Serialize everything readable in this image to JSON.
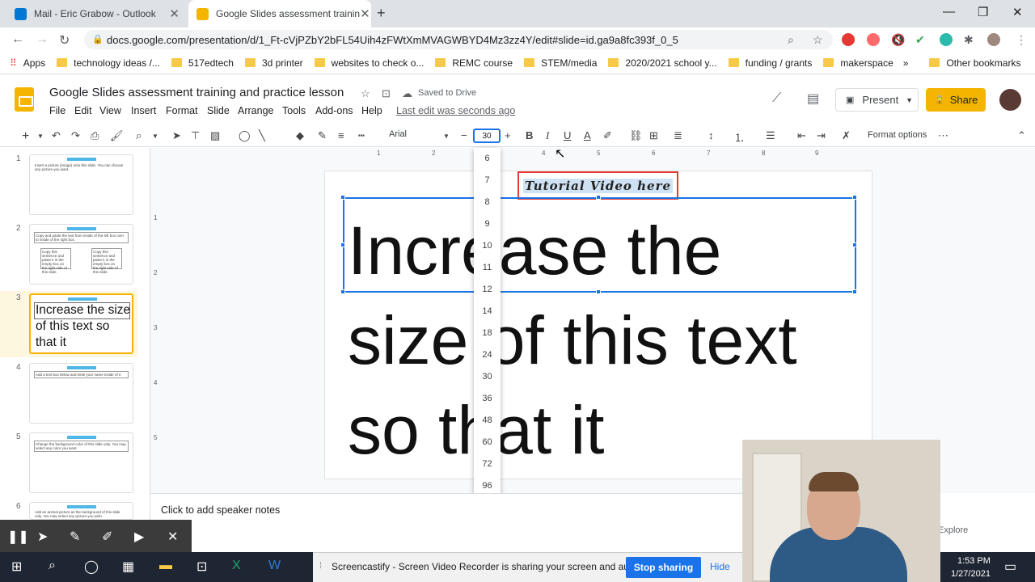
{
  "browser": {
    "tabs": [
      {
        "title": "Mail - Eric Grabow - Outlook",
        "favicon_color": "#0078d4"
      },
      {
        "title": "Google Slides assessment trainin",
        "favicon_color": "#f4b400"
      }
    ],
    "url": "docs.google.com/presentation/d/1_Ft-cVjPZbY2bFL54Uih4zFWtXmMVAGWBYD4Mz3zz4Y/edit#slide=id.ga9a8fc393f_0_5",
    "bookmarks": [
      "Apps",
      "technology ideas /...",
      "517edtech",
      "3d printer",
      "websites to check o...",
      "REMC course",
      "STEM/media",
      "2020/2021 school y...",
      "funding / grants",
      "makerspace"
    ],
    "other_bookmarks": "Other bookmarks",
    "more_bookmarks": "»"
  },
  "app": {
    "title": "Google Slides assessment training and practice lesson",
    "saved_status": "Saved to Drive",
    "menu": [
      "File",
      "Edit",
      "View",
      "Insert",
      "Format",
      "Slide",
      "Arrange",
      "Tools",
      "Add-ons",
      "Help"
    ],
    "last_edit": "Last edit was seconds ago",
    "present_label": "Present",
    "share_label": "Share",
    "accent": "#f4b400"
  },
  "toolbar": {
    "font_name": "Arial",
    "font_size": "30",
    "format_options": "Format options"
  },
  "ruler": [
    "1",
    "2",
    "3",
    "4",
    "5",
    "6",
    "7",
    "8",
    "9"
  ],
  "vruler": [
    "1",
    "2",
    "3",
    "4",
    "5"
  ],
  "font_sizes": [
    "6",
    "7",
    "8",
    "9",
    "10",
    "11",
    "12",
    "14",
    "18",
    "24",
    "30",
    "36",
    "48",
    "60",
    "72",
    "96"
  ],
  "slides": [
    {
      "num": "1",
      "text": "Insert a picture (image) onto this slide. You can choose any picture you want."
    },
    {
      "num": "2",
      "text": "Copy and paste the text from inside of the left box over to inside of the right box.",
      "box1": "Copy this sentence and paste it in the empty box on the right side of this slide."
    },
    {
      "num": "3",
      "text": "Increase the size of this text so that it"
    },
    {
      "num": "4",
      "text": "Add a text box below and write your name inside of it"
    },
    {
      "num": "5",
      "text": "Change the background color of this slide only. You may select any color you want."
    },
    {
      "num": "6",
      "text": "Add an animal picture as the background of this slide only. You may select any picture you wish."
    }
  ],
  "thumb_label": "Tutorial Video here",
  "slide": {
    "label": "Tutorial Video here",
    "text_lines": [
      "Increase the",
      "size of this text",
      "so that it"
    ]
  },
  "notes_placeholder": "Click to add speaker notes",
  "explore_label": "Explore",
  "screen_share": {
    "message": "Screencastify - Screen Video Recorder is sharing your screen and audio.",
    "stop_label": "Stop sharing",
    "hide_label": "Hide"
  },
  "clock": {
    "time": "1:53 PM",
    "date": "1/27/2021"
  }
}
